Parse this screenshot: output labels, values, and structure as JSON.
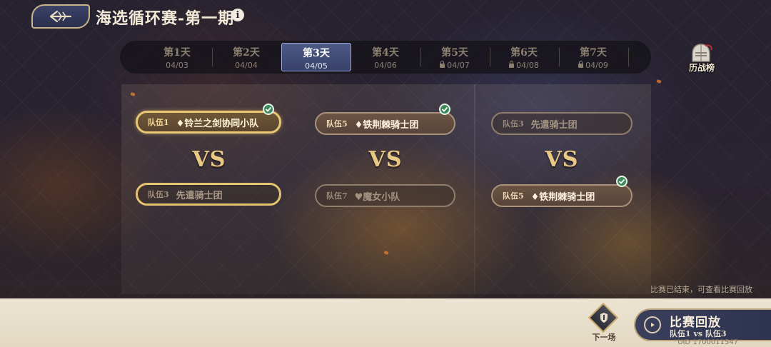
{
  "header": {
    "title": "海选循环赛-第一期",
    "info_icon": "ⅰ"
  },
  "tabs": [
    {
      "label": "第1天",
      "date": "04/03",
      "locked": false,
      "active": false
    },
    {
      "label": "第2天",
      "date": "04/04",
      "locked": false,
      "active": false
    },
    {
      "label": "第3天",
      "date": "04/05",
      "locked": false,
      "active": true
    },
    {
      "label": "第4天",
      "date": "04/06",
      "locked": false,
      "active": false
    },
    {
      "label": "第5天",
      "date": "04/07",
      "locked": true,
      "active": false
    },
    {
      "label": "第6天",
      "date": "04/08",
      "locked": true,
      "active": false
    },
    {
      "label": "第7天",
      "date": "04/09",
      "locked": true,
      "active": false
    }
  ],
  "history": {
    "label": "历战榜"
  },
  "matches": [
    {
      "top": {
        "tag": "队伍1",
        "name": "♦铃兰之剑协同小队",
        "winner": true
      },
      "vs": "VS",
      "bottom": {
        "tag": "队伍3",
        "name": "先遣骑士团",
        "winner": false
      }
    },
    {
      "top": {
        "tag": "队伍5",
        "name": "♦铁荆棘骑士团",
        "winner": true
      },
      "vs": "VS",
      "bottom": {
        "tag": "队伍7",
        "name": "♥魔女小队",
        "winner": false
      }
    },
    {
      "top": {
        "tag": "队伍3",
        "name": "先遣骑士团",
        "winner": false
      },
      "vs": "VS",
      "bottom": {
        "tag": "队伍5",
        "name": "♦铁荆棘骑士团",
        "winner": true
      }
    }
  ],
  "status_text": "比赛已结束，可查看比赛回放",
  "next_match": {
    "label": "下一场"
  },
  "replay": {
    "title": "比赛回放",
    "subtitle": "队伍1 vs 队伍3"
  },
  "uid": "UID 1700011547",
  "colors": {
    "accent_gold": "#e8c875",
    "active_tab": "#4e5a86",
    "win_check": "#3c8a5c"
  }
}
